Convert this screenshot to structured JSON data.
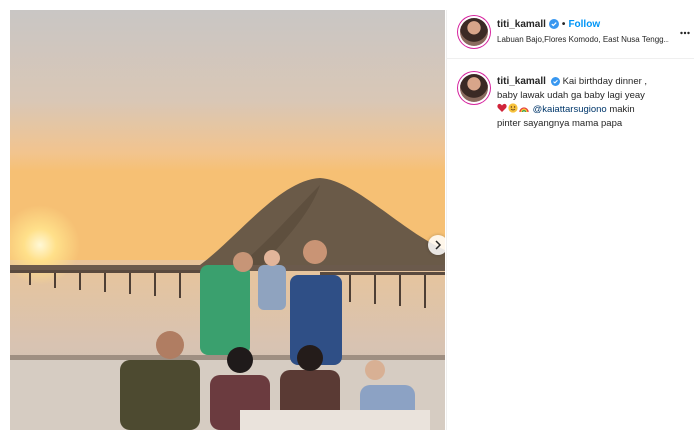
{
  "post": {
    "username": "titi_kamall",
    "follow_label": "Follow",
    "location": "Labuan Bajo,Flores Komodo, East Nusa Tengg...",
    "more_icon": "more-dots-icon",
    "caption_line1": "Kai birthday dinner ,",
    "caption_line2": "baby lawak udah ga baby lagi yeay",
    "mention": "@kaiattarsugiono",
    "caption_line3_rest": "makin",
    "caption_line4": "pinter sayangnya mama papa",
    "emojis": [
      "heart-emoji",
      "smiling-face-emoji",
      "rainbow-emoji"
    ]
  },
  "colors": {
    "follow": "#0095f6",
    "verified": "#3897f0",
    "mention": "#00376b"
  }
}
